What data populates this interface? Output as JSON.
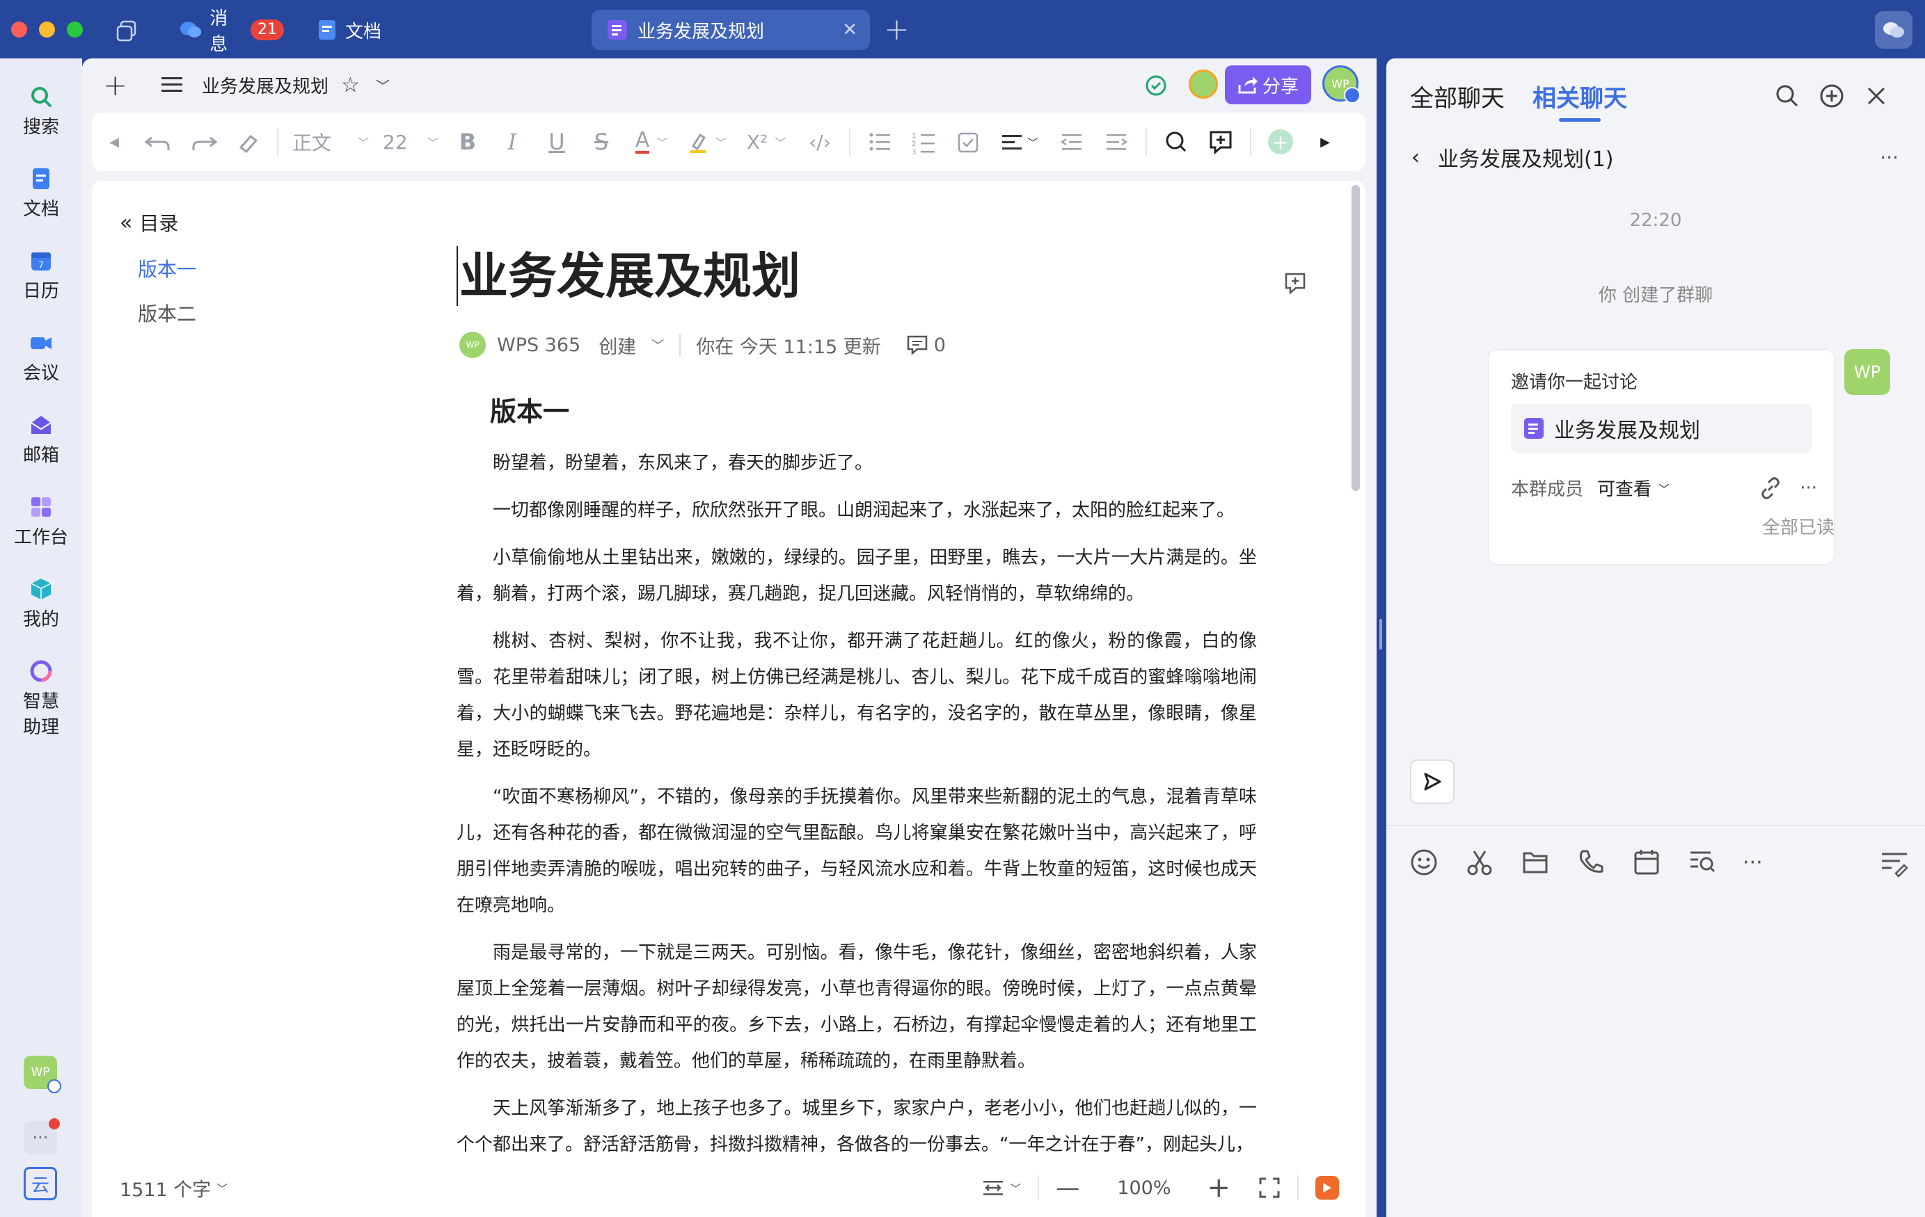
{
  "titlebar": {
    "tabs": [
      {
        "label": "消息",
        "badge": "21"
      },
      {
        "label": "文档"
      },
      {
        "label": "业务发展及规划",
        "active": true
      }
    ],
    "new_tab": "+"
  },
  "sidebar": {
    "items": [
      {
        "label": "搜索",
        "icon": "search-icon"
      },
      {
        "label": "文档",
        "icon": "doc-icon"
      },
      {
        "label": "日历",
        "icon": "calendar-icon"
      },
      {
        "label": "会议",
        "icon": "video-icon"
      },
      {
        "label": "邮箱",
        "icon": "mail-icon"
      },
      {
        "label": "工作台",
        "icon": "workbench-icon"
      },
      {
        "label": "我的",
        "icon": "cube-icon"
      },
      {
        "label": "智慧",
        "label2": "助理",
        "icon": "assistant-icon"
      }
    ],
    "avatar": "WP",
    "more": "···",
    "cloud": "云"
  },
  "doc_header": {
    "breadcrumb": "业务发展及规划",
    "share_label": "分享",
    "avatar": "WP"
  },
  "toolbar": {
    "style": "正文",
    "font_size": "22",
    "bold": "B",
    "italic": "I",
    "underline": "U",
    "strike": "S",
    "color": "A",
    "superscript": "X²"
  },
  "outline": {
    "title": "目录",
    "items": [
      "版本一",
      "版本二"
    ]
  },
  "document": {
    "title": "业务发展及规划",
    "author_avatar": "WP",
    "author": "WPS 365",
    "created": "创建",
    "updated": "你在 今天 11:15 更新",
    "comments": "0",
    "heading1": "版本一",
    "paragraphs": [
      "盼望着，盼望着，东风来了，春天的脚步近了。",
      "一切都像刚睡醒的样子，欣欣然张开了眼。山朗润起来了，水涨起来了，太阳的脸红起来了。",
      "小草偷偷地从土里钻出来，嫩嫩的，绿绿的。园子里，田野里，瞧去，一大片一大片满是的。坐着，躺着，打两个滚，踢几脚球，赛几趟跑，捉几回迷藏。风轻悄悄的，草软绵绵的。",
      "桃树、杏树、梨树，你不让我，我不让你，都开满了花赶趟儿。红的像火，粉的像霞，白的像雪。花里带着甜味儿；闭了眼，树上仿佛已经满是桃儿、杏儿、梨儿。花下成千成百的蜜蜂嗡嗡地闹着，大小的蝴蝶飞来飞去。野花遍地是：杂样儿，有名字的，没名字的，散在草丛里，像眼睛，像星星，还眨呀眨的。",
      "“吹面不寒杨柳风”，不错的，像母亲的手抚摸着你。风里带来些新翻的泥土的气息，混着青草味儿，还有各种花的香，都在微微润湿的空气里酝酿。鸟儿将窠巢安在繁花嫩叶当中，高兴起来了，呼朋引伴地卖弄清脆的喉咙，唱出宛转的曲子，与轻风流水应和着。牛背上牧童的短笛，这时候也成天在嘹亮地响。",
      "雨是最寻常的，一下就是三两天。可别恼。看，像牛毛，像花针，像细丝，密密地斜织着，人家屋顶上全笼着一层薄烟。树叶子却绿得发亮，小草也青得逼你的眼。傍晚时候，上灯了，一点点黄晕的光，烘托出一片安静而和平的夜。乡下去，小路上，石桥边，有撑起伞慢慢走着的人；还有地里工作的农夫，披着蓑，戴着笠。他们的草屋，稀稀疏疏的，在雨里静默着。",
      "天上风筝渐渐多了，地上孩子也多了。城里乡下，家家户户，老老小小，他们也赶趟儿似的，一个个都出来了。舒活舒活筋骨，抖擞抖擞精神，各做各的一份事去。“一年之计在于春”，刚起头儿，"
    ]
  },
  "statusbar": {
    "word_count": "1511 个字",
    "zoom": "100%"
  },
  "chat": {
    "tabs": [
      "全部聊天",
      "相关聊天"
    ],
    "active_tab": 1,
    "conversation_title": "业务发展及规划(1)",
    "time": "22:20",
    "system_msg": "你 创建了群聊",
    "card": {
      "title": "邀请你一起讨论",
      "doc_name": "业务发展及规划",
      "perm_label": "本群成员",
      "perm_value": "可查看"
    },
    "sender_avatar": "WP",
    "read_status": "全部已读"
  },
  "colors": {
    "brand_blue": "#27479c",
    "accent_purple": "#7b5cf0",
    "link_blue": "#3c6fe6",
    "avatar_green": "#9fd46c"
  }
}
